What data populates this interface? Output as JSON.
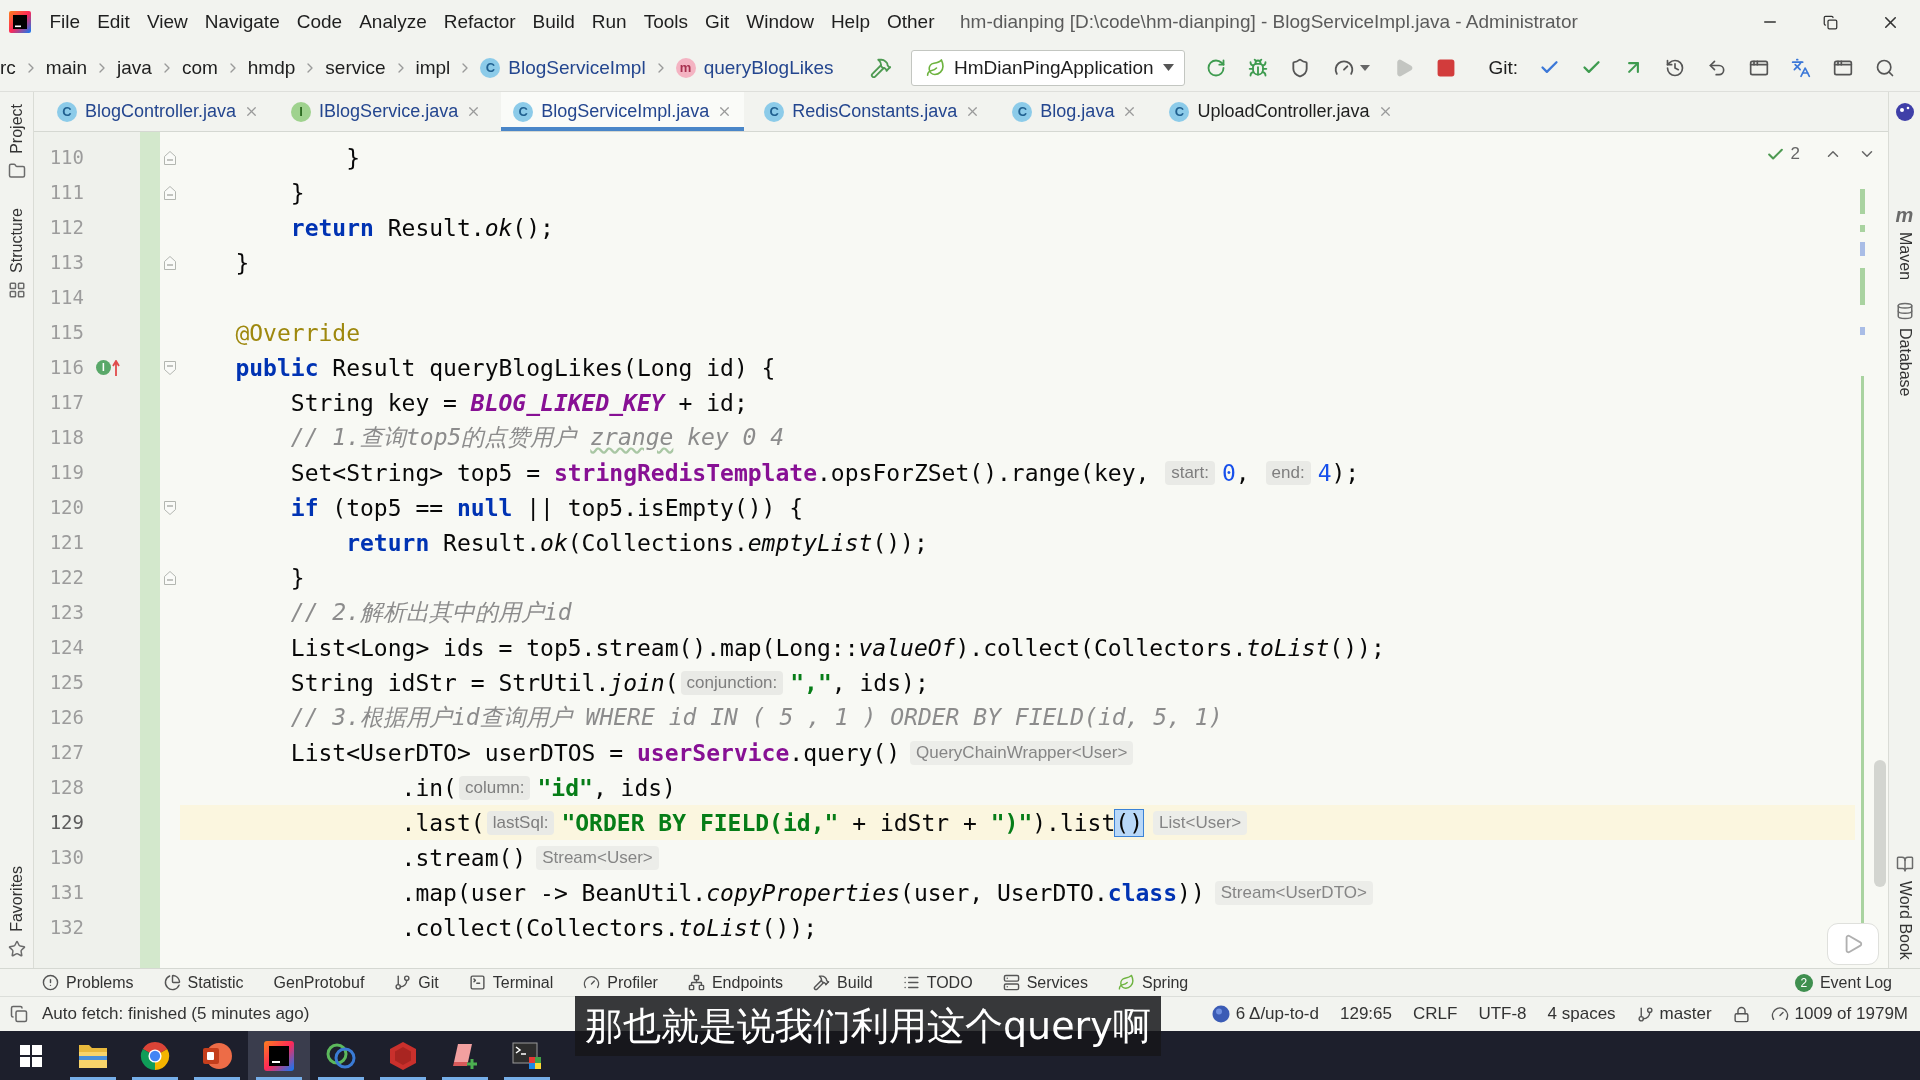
{
  "window": {
    "title": "hm-dianping [D:\\code\\hm-dianping] - BlogServiceImpl.java - Administrator",
    "menu": [
      "File",
      "Edit",
      "View",
      "Navigate",
      "Code",
      "Analyze",
      "Refactor",
      "Build",
      "Run",
      "Tools",
      "Git",
      "Window",
      "Help",
      "Other"
    ]
  },
  "navigation": {
    "breadcrumbs": [
      {
        "label": "rc",
        "kind": "folder"
      },
      {
        "label": "main",
        "kind": "folder"
      },
      {
        "label": "java",
        "kind": "folder"
      },
      {
        "label": "com",
        "kind": "folder"
      },
      {
        "label": "hmdp",
        "kind": "folder"
      },
      {
        "label": "service",
        "kind": "folder"
      },
      {
        "label": "impl",
        "kind": "folder"
      },
      {
        "label": "BlogServiceImpl",
        "kind": "class",
        "badge": "C"
      },
      {
        "label": "queryBlogLikes",
        "kind": "method",
        "badge": "m"
      }
    ],
    "run_configuration": "HmDianPingApplication",
    "run_tools": [
      {
        "kind": "rerun",
        "disabled": false
      },
      {
        "kind": "debug",
        "disabled": false
      },
      {
        "kind": "coverage",
        "disabled": false
      },
      {
        "kind": "profile",
        "disabled": false
      },
      {
        "kind": "run",
        "disabled": true
      },
      {
        "kind": "stop",
        "disabled": false
      }
    ],
    "vcs_label": "Git:"
  },
  "tabs": [
    {
      "label": "BlogController.java",
      "kind": "class",
      "badge": "C",
      "modified": true,
      "selected": false
    },
    {
      "label": "IBlogService.java",
      "kind": "interface",
      "badge": "I",
      "modified": true,
      "selected": false
    },
    {
      "label": "BlogServiceImpl.java",
      "kind": "class",
      "badge": "C",
      "modified": true,
      "selected": true
    },
    {
      "label": "RedisConstants.java",
      "kind": "class",
      "badge": "C",
      "modified": true,
      "selected": false
    },
    {
      "label": "Blog.java",
      "kind": "class",
      "badge": "C",
      "modified": true,
      "selected": false
    },
    {
      "label": "UploadController.java",
      "kind": "class",
      "badge": "C",
      "modified": false,
      "selected": false
    }
  ],
  "left_tools": {
    "top": [
      {
        "label": "Project",
        "kind": "project"
      },
      {
        "label": "Structure",
        "kind": "structure"
      }
    ],
    "bottom": [
      {
        "label": "Favorites",
        "kind": "favorites"
      }
    ]
  },
  "right_tools": {
    "top": [
      {
        "kind": "plugin"
      },
      {
        "label": "Maven",
        "kind": "maven",
        "badge": "m"
      },
      {
        "label": "Database",
        "kind": "database"
      }
    ],
    "bottom": [
      {
        "label": "Word Book",
        "kind": "wordbook"
      }
    ]
  },
  "editor": {
    "problems": "2",
    "lines": [
      {
        "number": "110",
        "fold_start": false,
        "fold_end": true,
        "current": false,
        "segments": [
          {
            "kind": "code",
            "tokens": [
              {
                "kind": "plain",
                "text": "            }"
              }
            ]
          }
        ]
      },
      {
        "number": "111",
        "fold_start": false,
        "fold_end": true,
        "current": false,
        "segments": [
          {
            "kind": "code",
            "tokens": [
              {
                "kind": "plain",
                "text": "        }"
              }
            ]
          }
        ]
      },
      {
        "number": "112",
        "fold_start": false,
        "fold_end": false,
        "current": false,
        "segments": [
          {
            "kind": "code",
            "tokens": [
              {
                "kind": "keyword",
                "text": "        return"
              },
              {
                "kind": "plain",
                "text": " Result."
              },
              {
                "kind": "static",
                "text": "ok"
              },
              {
                "kind": "plain",
                "text": "();"
              }
            ]
          }
        ]
      },
      {
        "number": "113",
        "fold_start": false,
        "fold_end": true,
        "current": false,
        "segments": [
          {
            "kind": "code",
            "tokens": [
              {
                "kind": "plain",
                "text": "    }"
              }
            ]
          }
        ]
      },
      {
        "number": "114",
        "fold_start": false,
        "fold_end": false,
        "current": false
      },
      {
        "number": "115",
        "fold_start": false,
        "fold_end": false,
        "current": false,
        "segments": [
          {
            "kind": "code",
            "tokens": [
              {
                "kind": "annotation",
                "text": "    @Override"
              }
            ]
          }
        ]
      },
      {
        "number": "116",
        "fold_start": true,
        "fold_end": false,
        "current": false,
        "gutter_badge": "I",
        "segments": [
          {
            "kind": "code",
            "tokens": [
              {
                "kind": "keyword",
                "text": "    public"
              },
              {
                "kind": "plain",
                "text": " Result queryBlogLikes(Long id) {"
              }
            ]
          }
        ]
      },
      {
        "number": "117",
        "fold_start": false,
        "fold_end": false,
        "current": false,
        "segments": [
          {
            "kind": "code",
            "tokens": [
              {
                "kind": "plain",
                "text": "        String key = "
              },
              {
                "kind": "constant",
                "text": "BLOG_LIKED_KEY"
              },
              {
                "kind": "plain",
                "text": " + id;"
              }
            ]
          }
        ]
      },
      {
        "number": "118",
        "fold_start": false,
        "fold_end": false,
        "current": false,
        "segments": [
          {
            "kind": "code",
            "tokens": [
              {
                "kind": "comment",
                "text": "        // 1.查询top5的点赞用户 "
              },
              {
                "kind": "typo",
                "text": "zrange"
              },
              {
                "kind": "comment",
                "text": " key 0 4"
              }
            ]
          }
        ]
      },
      {
        "number": "119",
        "fold_start": false,
        "fold_end": false,
        "current": false,
        "segments": [
          {
            "kind": "code",
            "tokens": [
              {
                "kind": "plain",
                "text": "        Set<String> top5 = "
              },
              {
                "kind": "field",
                "text": "stringRedisTemplate"
              },
              {
                "kind": "plain",
                "text": ".opsForZSet().range(key, "
              }
            ]
          },
          {
            "kind": "hint",
            "text": "start:"
          },
          {
            "kind": "code",
            "tokens": [
              {
                "kind": "number",
                "text": "0"
              },
              {
                "kind": "plain",
                "text": ", "
              }
            ]
          },
          {
            "kind": "hint",
            "text": "end:"
          },
          {
            "kind": "code",
            "tokens": [
              {
                "kind": "number",
                "text": "4"
              },
              {
                "kind": "plain",
                "text": ");"
              }
            ]
          }
        ]
      },
      {
        "number": "120",
        "fold_start": true,
        "fold_end": false,
        "current": false,
        "segments": [
          {
            "kind": "code",
            "tokens": [
              {
                "kind": "keyword",
                "text": "        if"
              },
              {
                "kind": "plain",
                "text": " (top5 == "
              },
              {
                "kind": "keyword",
                "text": "null"
              },
              {
                "kind": "plain",
                "text": " || top5.isEmpty()) {"
              }
            ]
          }
        ]
      },
      {
        "number": "121",
        "fold_start": false,
        "fold_end": false,
        "current": false,
        "segments": [
          {
            "kind": "code",
            "tokens": [
              {
                "kind": "keyword",
                "text": "            return"
              },
              {
                "kind": "plain",
                "text": " Result."
              },
              {
                "kind": "static",
                "text": "ok"
              },
              {
                "kind": "plain",
                "text": "(Collections."
              },
              {
                "kind": "static",
                "text": "emptyList"
              },
              {
                "kind": "plain",
                "text": "());"
              }
            ]
          }
        ]
      },
      {
        "number": "122",
        "fold_start": false,
        "fold_end": true,
        "current": false,
        "segments": [
          {
            "kind": "code",
            "tokens": [
              {
                "kind": "plain",
                "text": "        }"
              }
            ]
          }
        ]
      },
      {
        "number": "123",
        "fold_start": false,
        "fold_end": false,
        "current": false,
        "segments": [
          {
            "kind": "code",
            "tokens": [
              {
                "kind": "comment",
                "text": "        // 2.解析出其中的用户id"
              }
            ]
          }
        ]
      },
      {
        "number": "124",
        "fold_start": false,
        "fold_end": false,
        "current": false,
        "segments": [
          {
            "kind": "code",
            "tokens": [
              {
                "kind": "plain",
                "text": "        List<Long> ids = top5.stream().map(Long::"
              },
              {
                "kind": "static",
                "text": "valueOf"
              },
              {
                "kind": "plain",
                "text": ").collect(Collectors."
              },
              {
                "kind": "static",
                "text": "toList"
              },
              {
                "kind": "plain",
                "text": "());"
              }
            ]
          }
        ]
      },
      {
        "number": "125",
        "fold_start": false,
        "fold_end": false,
        "current": false,
        "segments": [
          {
            "kind": "code",
            "tokens": [
              {
                "kind": "plain",
                "text": "        String idStr = StrUtil."
              },
              {
                "kind": "static",
                "text": "join"
              },
              {
                "kind": "plain",
                "text": "("
              }
            ]
          },
          {
            "kind": "hint",
            "text": "conjunction:"
          },
          {
            "kind": "code",
            "tokens": [
              {
                "kind": "string",
                "text": "\",\""
              },
              {
                "kind": "plain",
                "text": ", ids);"
              }
            ]
          }
        ]
      },
      {
        "number": "126",
        "fold_start": false,
        "fold_end": false,
        "current": false,
        "segments": [
          {
            "kind": "code",
            "tokens": [
              {
                "kind": "comment",
                "text": "        // 3.根据用户id查询用户 WHERE id IN ( 5 , 1 ) ORDER BY FIELD(id, 5, 1)"
              }
            ]
          }
        ]
      },
      {
        "number": "127",
        "fold_start": false,
        "fold_end": false,
        "current": false,
        "segments": [
          {
            "kind": "code",
            "tokens": [
              {
                "kind": "plain",
                "text": "        List<UserDTO> userDTOS = "
              },
              {
                "kind": "field",
                "text": "userService"
              },
              {
                "kind": "plain",
                "text": ".query()"
              }
            ]
          },
          {
            "kind": "type_hint",
            "text": "QueryChainWrapper<User>"
          }
        ]
      },
      {
        "number": "128",
        "fold_start": false,
        "fold_end": false,
        "current": false,
        "segments": [
          {
            "kind": "code",
            "tokens": [
              {
                "kind": "plain",
                "text": "                .in("
              }
            ]
          },
          {
            "kind": "hint",
            "text": "column:"
          },
          {
            "kind": "code",
            "tokens": [
              {
                "kind": "string",
                "text": "\"id\""
              },
              {
                "kind": "plain",
                "text": ", ids)"
              }
            ]
          }
        ]
      },
      {
        "number": "129",
        "fold_start": false,
        "fold_end": false,
        "current": true,
        "segments": [
          {
            "kind": "code",
            "tokens": [
              {
                "kind": "plain",
                "text": "                .last("
              }
            ]
          },
          {
            "kind": "hint",
            "text": "lastSql:"
          },
          {
            "kind": "code",
            "tokens": [
              {
                "kind": "string",
                "text": "\"ORDER BY FIELD(id,\""
              },
              {
                "kind": "plain",
                "text": " + idStr + "
              },
              {
                "kind": "string",
                "text": "\")\""
              },
              {
                "kind": "plain",
                "text": ").list"
              },
              {
                "kind": "match",
                "text": "()"
              }
            ]
          },
          {
            "kind": "type_hint",
            "text": "List<User>"
          }
        ]
      },
      {
        "number": "130",
        "fold_start": false,
        "fold_end": false,
        "current": false,
        "segments": [
          {
            "kind": "code",
            "tokens": [
              {
                "kind": "plain",
                "text": "                .stream()"
              }
            ]
          },
          {
            "kind": "type_hint",
            "text": "Stream<User>"
          }
        ]
      },
      {
        "number": "131",
        "fold_start": false,
        "fold_end": false,
        "current": false,
        "segments": [
          {
            "kind": "code",
            "tokens": [
              {
                "kind": "plain",
                "text": "                .map(user -> BeanUtil."
              },
              {
                "kind": "static",
                "text": "copyProperties"
              },
              {
                "kind": "plain",
                "text": "(user, UserDTO."
              },
              {
                "kind": "keyword",
                "text": "class"
              },
              {
                "kind": "plain",
                "text": "))"
              }
            ]
          },
          {
            "kind": "type_hint",
            "text": "Stream<UserDTO>"
          }
        ]
      },
      {
        "number": "132",
        "fold_start": false,
        "fold_end": false,
        "current": false,
        "segments": [
          {
            "kind": "code",
            "tokens": [
              {
                "kind": "plain",
                "text": "                .collect(Collectors."
              },
              {
                "kind": "static",
                "text": "toList"
              },
              {
                "kind": "plain",
                "text": "());"
              }
            ]
          }
        ]
      }
    ]
  },
  "tool_windows": [
    {
      "label": "Problems",
      "kind": "problems"
    },
    {
      "label": "Statistic",
      "kind": "statistic"
    },
    {
      "label": "GenProtobuf",
      "kind": "plain"
    },
    {
      "label": "Git",
      "kind": "git"
    },
    {
      "label": "Terminal",
      "kind": "terminal"
    },
    {
      "label": "Profiler",
      "kind": "profiler"
    },
    {
      "label": "Endpoints",
      "kind": "endpoints"
    },
    {
      "label": "Build",
      "kind": "build"
    },
    {
      "label": "TODO",
      "kind": "todo"
    },
    {
      "label": "Services",
      "kind": "services"
    },
    {
      "label": "Spring",
      "kind": "spring"
    }
  ],
  "event_log": {
    "label": "Event Log",
    "count": "2"
  },
  "status_bar": {
    "message": "Auto fetch: finished (5 minutes ago)",
    "items": [
      {
        "kind": "vcs",
        "text": "6 Δ/up-to-d"
      },
      {
        "kind": "text",
        "text": "129:65"
      },
      {
        "kind": "text",
        "text": "CRLF"
      },
      {
        "kind": "text",
        "text": "UTF-8"
      },
      {
        "kind": "text",
        "text": "4 spaces"
      },
      {
        "kind": "branch",
        "text": "master"
      },
      {
        "kind": "lock"
      },
      {
        "kind": "memory",
        "text": "1009 of 1979M"
      }
    ]
  },
  "taskbar": {
    "apps": [
      {
        "kind": "folder",
        "running": true,
        "selected": false
      },
      {
        "kind": "browser",
        "running": true,
        "selected": false
      },
      {
        "kind": "slides",
        "running": true,
        "selected": false
      },
      {
        "kind": "ide",
        "running": true,
        "selected": true
      },
      {
        "kind": "rings",
        "running": true,
        "selected": false
      },
      {
        "kind": "hexagon",
        "running": true,
        "selected": false
      },
      {
        "kind": "eraser",
        "running": true,
        "selected": false
      },
      {
        "kind": "terminal",
        "running": true,
        "selected": false
      }
    ]
  },
  "subtitle": "那也就是说我们利用这个query啊"
}
